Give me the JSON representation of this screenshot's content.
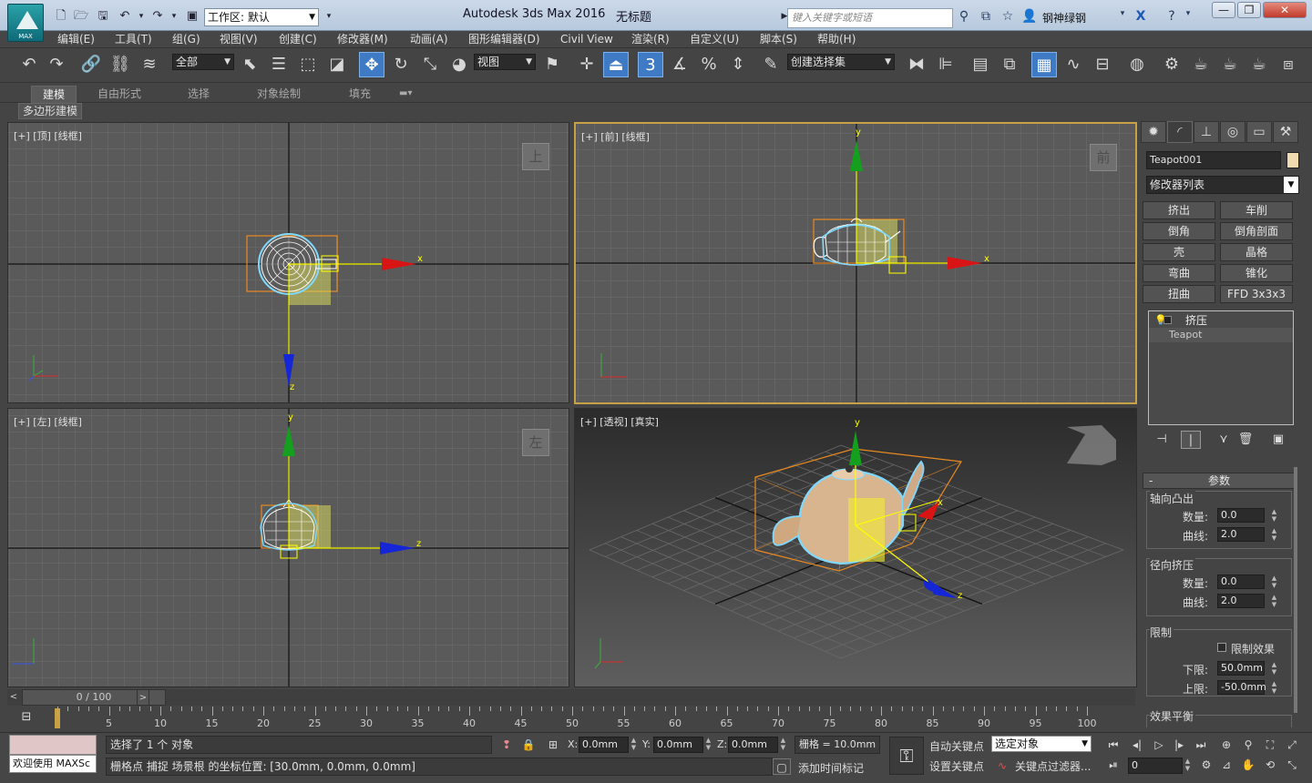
{
  "title": {
    "logo_caption": "MAX",
    "workspace_label": "工作区: 默认",
    "app_title": "Autodesk 3ds Max 2016",
    "document_title": "无标题",
    "search_placeholder": "键入关键字或短语",
    "username": "钢神绿钢"
  },
  "menu": [
    "编辑(E)",
    "工具(T)",
    "组(G)",
    "视图(V)",
    "创建(C)",
    "修改器(M)",
    "动画(A)",
    "图形编辑器(D)",
    "Civil View",
    "渲染(R)",
    "自定义(U)",
    "脚本(S)",
    "帮助(H)"
  ],
  "toolbar": {
    "filter_value": "全部",
    "refcoord_value": "视图",
    "snap_number": "3",
    "selection_set": "创建选择集"
  },
  "ribbon": {
    "tabs": [
      "建模",
      "自由形式",
      "选择",
      "对象绘制",
      "填充"
    ],
    "active_tab": "建模",
    "sub_label": "多边形建模"
  },
  "viewports": {
    "top": {
      "label": "[+] [顶] [线框]",
      "cube": "上"
    },
    "front": {
      "label": "[+] [前] [线框]",
      "cube": "前"
    },
    "left": {
      "label": "[+] [左] [线框]",
      "cube": "左"
    },
    "persp": {
      "label": "[+] [透视] [真实]"
    }
  },
  "axes": {
    "x": "x",
    "y": "y",
    "z": "z"
  },
  "panel": {
    "object_name": "Teapot001",
    "object_color": "#f0dcb0",
    "modifier_list": "修改器列表",
    "modifier_buttons": [
      "挤出",
      "车削",
      "倒角",
      "倒角剖面",
      "壳",
      "晶格",
      "弯曲",
      "锥化",
      "扭曲",
      "FFD 3x3x3"
    ],
    "stack": {
      "modifier": "挤压",
      "base": "Teapot"
    },
    "rollout_title": "参数",
    "axial_group": "轴向凸出",
    "radial_group": "径向挤压",
    "limit_group": "限制",
    "effect_balance": "效果平衡",
    "amount_label": "数量:",
    "curve_label": "曲线:",
    "axial_amount": "0.0",
    "axial_curve": "2.0",
    "radial_amount": "0.0",
    "radial_curve": "2.0",
    "limit_effect": "限制效果",
    "lower_label": "下限:",
    "upper_label": "上限:",
    "lower_value": "50.0mm",
    "upper_value": "-50.0mm"
  },
  "timeline": {
    "slider": "0 / 100",
    "ticks": [
      "5",
      "10",
      "15",
      "20",
      "25",
      "30",
      "35",
      "40",
      "45",
      "50",
      "55",
      "60",
      "65",
      "70",
      "75",
      "80",
      "85",
      "90",
      "95",
      "100"
    ]
  },
  "status": {
    "welcome": "欢迎使用 MAXSc",
    "selected": "选择了 1 个 对象",
    "prompt": "栅格点 捕捉 场景根 的坐标位置: [30.0mm, 0.0mm, 0.0mm]",
    "x_label": "X:",
    "y_label": "Y:",
    "z_label": "Z:",
    "x_value": "0.0mm",
    "y_value": "0.0mm",
    "z_value": "0.0mm",
    "grid": "栅格 = 10.0mm",
    "add_time_tag": "添加时间标记",
    "auto_key": "自动关键点",
    "set_key": "设置关键点",
    "key_target": "选定对象",
    "key_filters": "关键点过滤器...",
    "frame": "0"
  }
}
